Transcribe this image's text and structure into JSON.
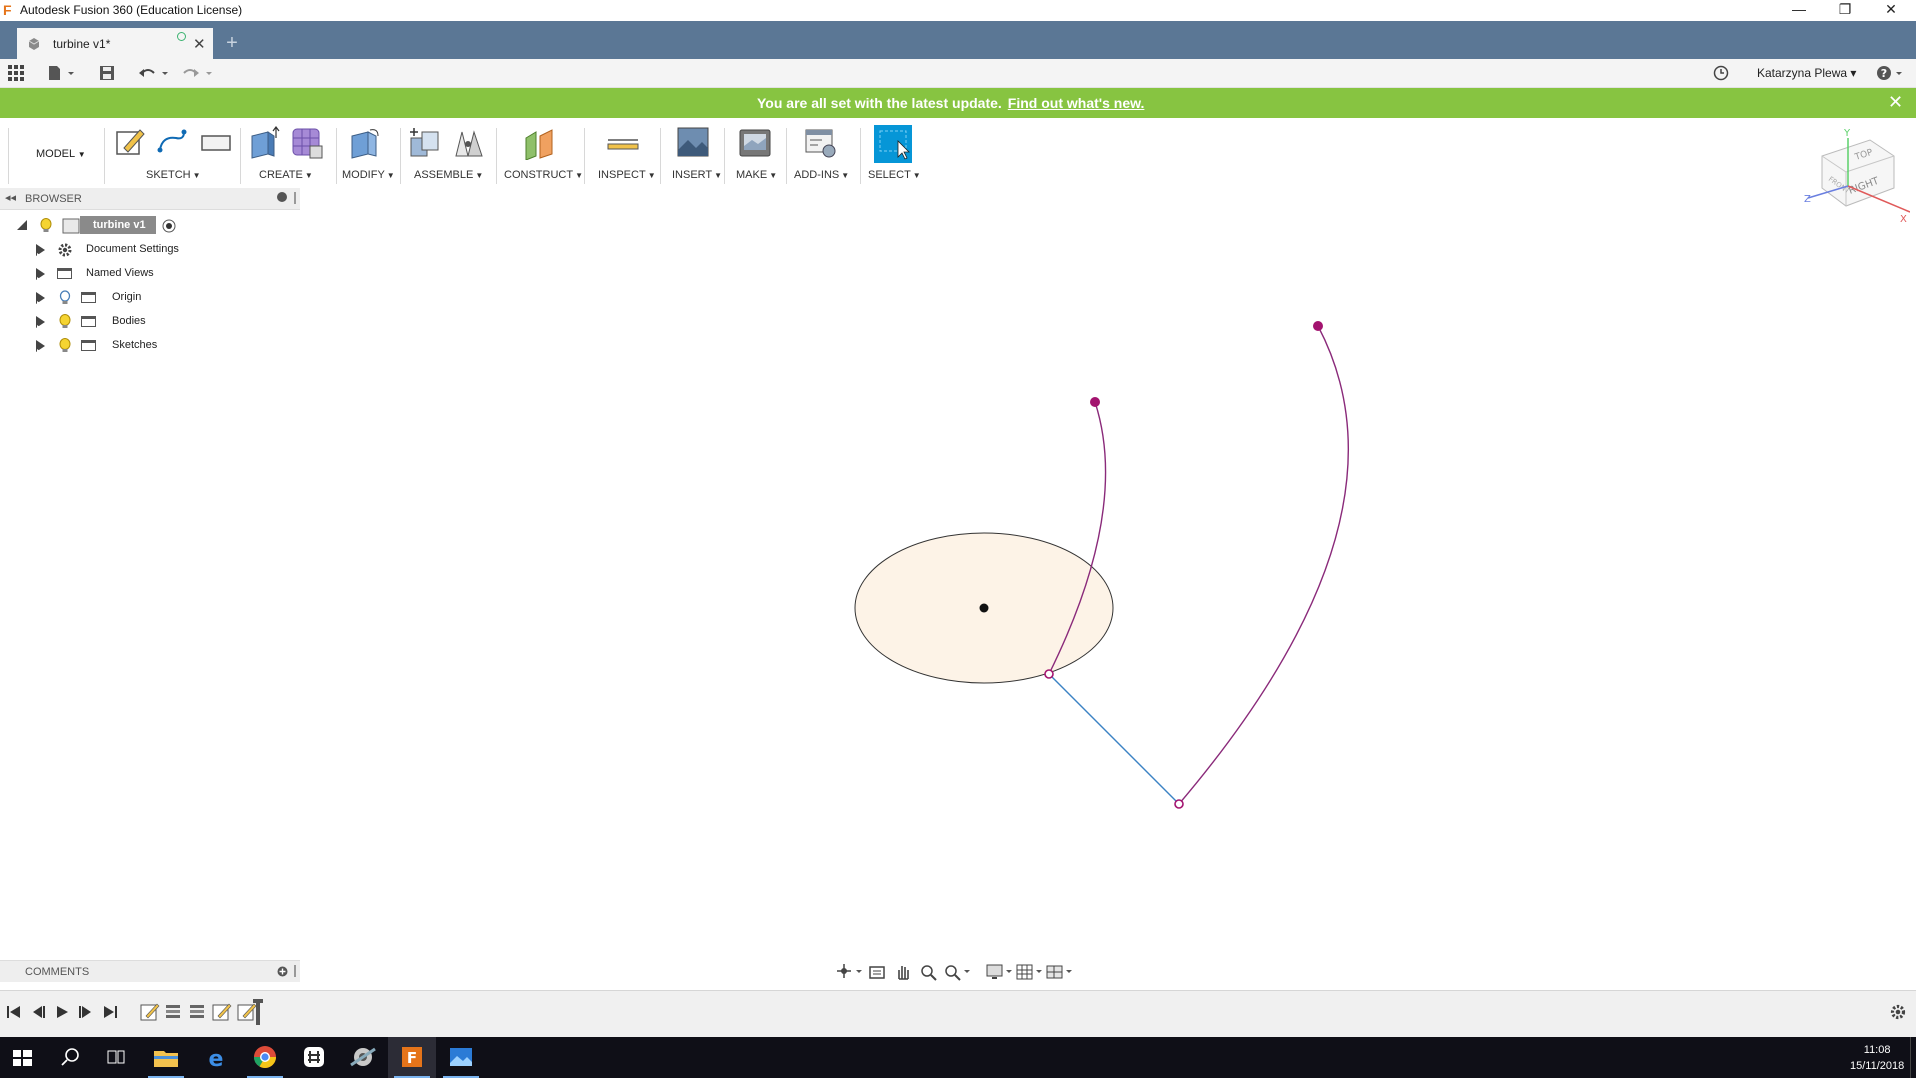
{
  "window": {
    "title": "Autodesk Fusion 360 (Education License)",
    "minimize": "—",
    "restore": "❐",
    "close": "✕"
  },
  "tab": {
    "label": "turbine v1*",
    "close": "✕",
    "new": "+"
  },
  "quickbar": {
    "user": "Katarzyna Plewa ▾",
    "help": "?"
  },
  "notification": {
    "message": "You are all set with the latest update.",
    "link": "Find out what's new.",
    "close": "✕"
  },
  "toolbar": {
    "workspace": "MODEL",
    "groups": [
      "SKETCH",
      "CREATE",
      "MODIFY",
      "ASSEMBLE",
      "CONSTRUCT",
      "INSPECT",
      "INSERT",
      "MAKE",
      "ADD-INS",
      "SELECT"
    ]
  },
  "browser": {
    "title": "BROWSER",
    "root": "turbine v1",
    "items": [
      "Document Settings",
      "Named Views",
      "Origin",
      "Bodies",
      "Sketches"
    ]
  },
  "comments": {
    "title": "COMMENTS"
  },
  "viewcube": {
    "top": "TOP",
    "right": "RIGHT",
    "front": "FRONT",
    "x": "X",
    "y": "Y",
    "z": "Z"
  },
  "taskbar": {
    "time": "11:08",
    "date": "15/11/2018"
  },
  "colors": {
    "accent": "#0696d7",
    "notify": "#87c441",
    "sketch_curve": "#8a2a7a",
    "sketch_point": "#a3136f",
    "construction_line": "#3b82c4",
    "profile_fill": "#fdf3e7"
  }
}
